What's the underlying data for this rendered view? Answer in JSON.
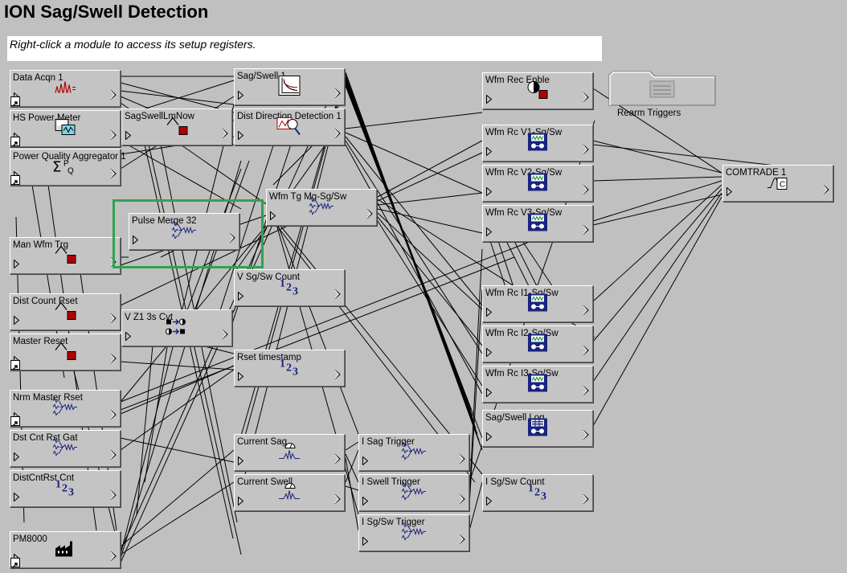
{
  "window": {
    "title": "ION Sag/Swell Detection",
    "instruction": "Right-click a module to access its setup registers."
  },
  "folder": {
    "label": "Rearm Triggers",
    "icon": "folder-icon"
  },
  "modules": {
    "data_acqn": {
      "label": "Data Acqn 1",
      "icon": "data-acquisition-icon"
    },
    "hs_power_meter": {
      "label": "HS Power Meter",
      "icon": "power-meter-icon"
    },
    "pq_aggregator": {
      "label": "Power Quality Aggregator 1",
      "icon": "sum-pq-icon"
    },
    "man_wfm_trg": {
      "label": "Man Wfm Trg",
      "icon": "pulse-trigger-icon"
    },
    "dist_count_rset": {
      "label": "Dist Count Rset",
      "icon": "pulse-trigger-icon"
    },
    "master_reset": {
      "label": "Master Reset",
      "icon": "pulse-trigger-icon"
    },
    "nrm_master_rset": {
      "label": "Nrm Master Rset",
      "icon": "pulse-merge-icon"
    },
    "dst_cnt_rst_gat": {
      "label": "Dst Cnt Rst Gat",
      "icon": "pulse-merge-icon"
    },
    "distcntrst_cnt": {
      "label": "DistCntRst Cnt",
      "icon": "counter-icon"
    },
    "pm8000": {
      "label": "PM8000",
      "icon": "factory-icon"
    },
    "sagswell_lmnow": {
      "label": "SagSwellLmNow",
      "icon": "pulse-trigger-icon"
    },
    "pulse_merge_32": {
      "label": "Pulse Merge 32",
      "icon": "pulse-merge-icon"
    },
    "v_z1_3s_cvt": {
      "label": "V Z1 3s Cvt",
      "icon": "converter-icon"
    },
    "sag_swell_1": {
      "label": "Sag/Swell 1",
      "icon": "sag-swell-curve-icon"
    },
    "dist_direction": {
      "label": "Dist Direction Detection 1",
      "icon": "direction-detection-icon"
    },
    "wfm_tg_mg": {
      "label": "Wfm Tg Mg-Sg/Sw",
      "icon": "pulse-merge-icon"
    },
    "v_sgsw_count": {
      "label": "V Sg/Sw Count",
      "icon": "counter-icon"
    },
    "rset_timestamp": {
      "label": "Rset timestamp",
      "icon": "counter-icon"
    },
    "current_sag": {
      "label": "Current Sag",
      "icon": "setpoint-icon"
    },
    "current_swell": {
      "label": "Current Swell",
      "icon": "setpoint-icon"
    },
    "i_sag_trigger": {
      "label": "I Sag Trigger",
      "icon": "pulse-merge-icon"
    },
    "i_swell_trigger": {
      "label": "I Swell Trigger",
      "icon": "pulse-merge-icon"
    },
    "i_sgsw_trigger": {
      "label": "I Sg/Sw Trigger",
      "icon": "pulse-merge-icon"
    },
    "wfm_rec_enble": {
      "label": "Wfm Rec Enble",
      "icon": "external-boolean-icon"
    },
    "wfm_rc_v1": {
      "label": "Wfm Rc V1-Sg/Sw",
      "icon": "waveform-recorder-icon"
    },
    "wfm_rc_v2": {
      "label": "Wfm Rc V2-Sg/Sw",
      "icon": "waveform-recorder-icon"
    },
    "wfm_rc_v3": {
      "label": "Wfm Rc V3-Sg/Sw",
      "icon": "waveform-recorder-icon"
    },
    "wfm_rc_i1": {
      "label": "Wfm Rc I1-Sg/Sw",
      "icon": "waveform-recorder-icon"
    },
    "wfm_rc_i2": {
      "label": "Wfm Rc I2-Sg/Sw",
      "icon": "waveform-recorder-icon"
    },
    "wfm_rc_i3": {
      "label": "Wfm Rc I3-Sg/Sw",
      "icon": "waveform-recorder-icon"
    },
    "sag_swell_log": {
      "label": "Sag/Swell Log",
      "icon": "data-recorder-icon"
    },
    "i_sgsw_count": {
      "label": "I Sg/Sw Count",
      "icon": "counter-icon"
    },
    "comtrade": {
      "label": "COMTRADE 1",
      "icon": "comtrade-icon"
    }
  },
  "colors": {
    "background": "#c0c0c0",
    "wire": "#000000",
    "highlight": "#2ea44f",
    "icon_blue": "#1a237e",
    "icon_red": "#b00000"
  }
}
